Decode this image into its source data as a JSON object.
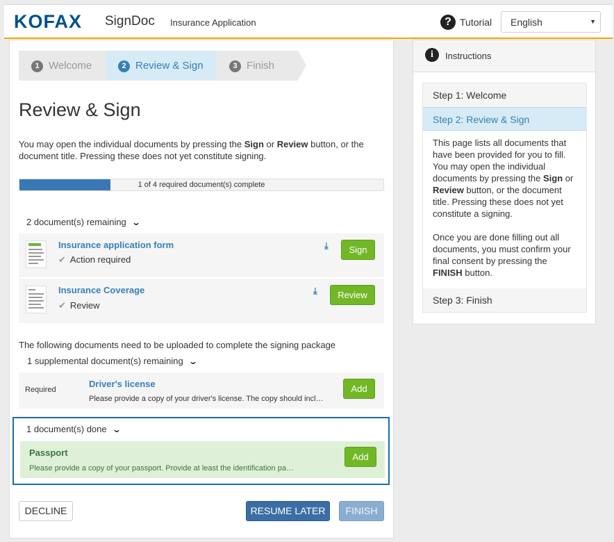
{
  "header": {
    "logo": "KOFAX",
    "product": "SignDoc",
    "app_title": "Insurance Application",
    "tutorial_label": "Tutorial",
    "language": "English"
  },
  "wizard": {
    "steps": [
      {
        "num": "1",
        "label": "Welcome"
      },
      {
        "num": "2",
        "label": "Review & Sign"
      },
      {
        "num": "3",
        "label": "Finish"
      }
    ],
    "active_step": 2
  },
  "page": {
    "title": "Review & Sign",
    "intro_1": "You may open the individual documents by pressing the ",
    "intro_sign": "Sign",
    "intro_2": " or ",
    "intro_review": "Review",
    "intro_3": " button, or the document title. Pressing these does not yet constitute signing."
  },
  "progress": {
    "completed": 1,
    "required": 4,
    "fraction": 0.25,
    "text": "1 of 4 required document(s) complete"
  },
  "remaining_group": {
    "label": "2 document(s) remaining",
    "documents": [
      {
        "title": "Insurance application form",
        "status": "Action required",
        "action": "Sign"
      },
      {
        "title": "Insurance Coverage",
        "status": "Review",
        "action": "Review"
      }
    ]
  },
  "upload_note": "The following documents need to be uploaded to complete the signing package",
  "supplemental_group": {
    "label": "1 supplemental document(s) remaining",
    "documents": [
      {
        "required_label": "Required",
        "title": "Driver's license",
        "description": "Please provide a copy of your driver's license. The copy should incl…",
        "action": "Add"
      }
    ]
  },
  "done_group": {
    "label": "1 document(s) done",
    "documents": [
      {
        "title": "Passport",
        "description": "Please provide a copy of your passport. Provide at least the identification pa…",
        "action": "Add"
      }
    ]
  },
  "footer": {
    "decline": "DECLINE",
    "resume_later": "RESUME LATER",
    "finish": "FINISH"
  },
  "instructions": {
    "title": "Instructions",
    "steps": [
      "Step 1: Welcome",
      "Step 2: Review & Sign",
      "Step 3: Finish"
    ],
    "body_p1_a": "This page lists all documents that have been provided for you to fill. You may open the individual documents by pressing the ",
    "body_p1_sign": "Sign",
    "body_p1_b": " or ",
    "body_p1_review": "Review",
    "body_p1_c": " button, or the document title. Pressing these does not yet constitute a signing.",
    "body_p2_a": "Once you are done filling out all documents, you must confirm your final consent by pressing the ",
    "body_p2_finish": "FINISH",
    "body_p2_b": " button."
  },
  "colors": {
    "brand": "#00508c",
    "accent_bar": "#f2a900",
    "primary": "#3580b8",
    "green": "#72b826",
    "done_bg": "#dff0d8",
    "highlight_border": "#1a6ea3"
  },
  "icons": {
    "help": "question-circle-icon",
    "info": "info-circle-icon",
    "download": "download-icon",
    "check": "check-icon",
    "chevron": "chevron-down-icon"
  }
}
